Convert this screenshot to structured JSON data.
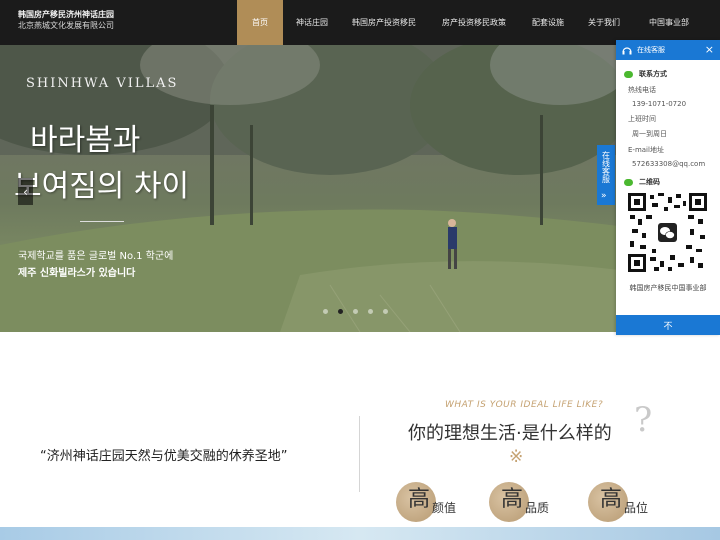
{
  "header": {
    "brand_line1": "韩国房产移民济州神话庄园",
    "brand_line2": "北京燕城文化发展有限公司",
    "nav": [
      {
        "label": "首页",
        "active": true
      },
      {
        "label": "神话庄园",
        "active": false
      },
      {
        "label": "韩国房产投资移民",
        "active": false
      },
      {
        "label": "房产投资移民政策",
        "active": false
      },
      {
        "label": "配套设施",
        "active": false
      },
      {
        "label": "关于我们",
        "active": false
      },
      {
        "label": "中国事业部",
        "active": false
      }
    ]
  },
  "hero": {
    "english_title": "SHINHWA VILLAS",
    "korean_line1": "바라봄과",
    "korean_line2": "보여짐의 차이",
    "sub_line1": "국제학교를 품은 글로벌 No.1 학군에",
    "sub_line2": "제주 신화빌라스가 있습니다",
    "prev_arrow": "‹",
    "slide_count": 5,
    "active_slide": 1
  },
  "service_tab": {
    "label": "在线客服",
    "chevron": "»"
  },
  "service_panel": {
    "title": "在线客服",
    "close": "×",
    "contact_title": "联系方式",
    "hotline_label": "热线电话",
    "hotline_value": "139-1071-0720",
    "hours_label": "上班时间",
    "hours_value": "周一到周日",
    "email_label": "E-mail地址",
    "email_value": "572633308@qq.com",
    "qr_title": "二维码",
    "qr_caption": "韩国房产移民中国事业部",
    "bottom_label": "不"
  },
  "content": {
    "quote": "“济州神话庄园天然与优美交融的休养圣地”",
    "ideal_english": "WHAT IS YOUR IDEAL LIFE LIKE?",
    "ideal_chinese": "你的理想生活·是什么样的",
    "question_mark": "?",
    "cross": "※",
    "features": [
      {
        "big": "高",
        "small": "颜值"
      },
      {
        "big": "高",
        "small": "品质"
      },
      {
        "big": "高",
        "small": "品位"
      }
    ]
  },
  "colors": {
    "header_bg": "#1b1b1b",
    "nav_active": "#b08d57",
    "service_blue": "#1a78d4",
    "gold": "#c5a272"
  }
}
